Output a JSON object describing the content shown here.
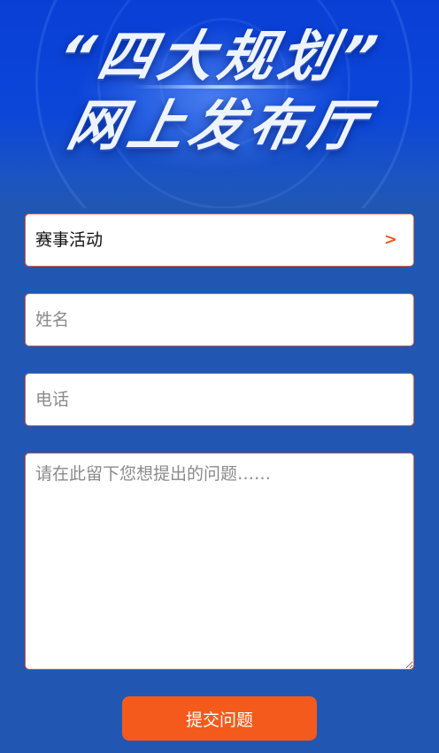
{
  "header": {
    "title_line1": "“四大规划”",
    "title_line2": "网上发布厅"
  },
  "form": {
    "category": {
      "value": "赛事活动",
      "arrow": ">"
    },
    "name": {
      "placeholder": "姓名",
      "value": ""
    },
    "phone": {
      "placeholder": "电话",
      "value": ""
    },
    "question": {
      "placeholder": "请在此留下您想提出的问题……",
      "value": ""
    },
    "submit_label": "提交问题"
  },
  "colors": {
    "page_bg": "#2156b3",
    "hero_blue": "#0b46d9",
    "field_border": "#e0603a",
    "accent_orange": "#f45a1c"
  }
}
